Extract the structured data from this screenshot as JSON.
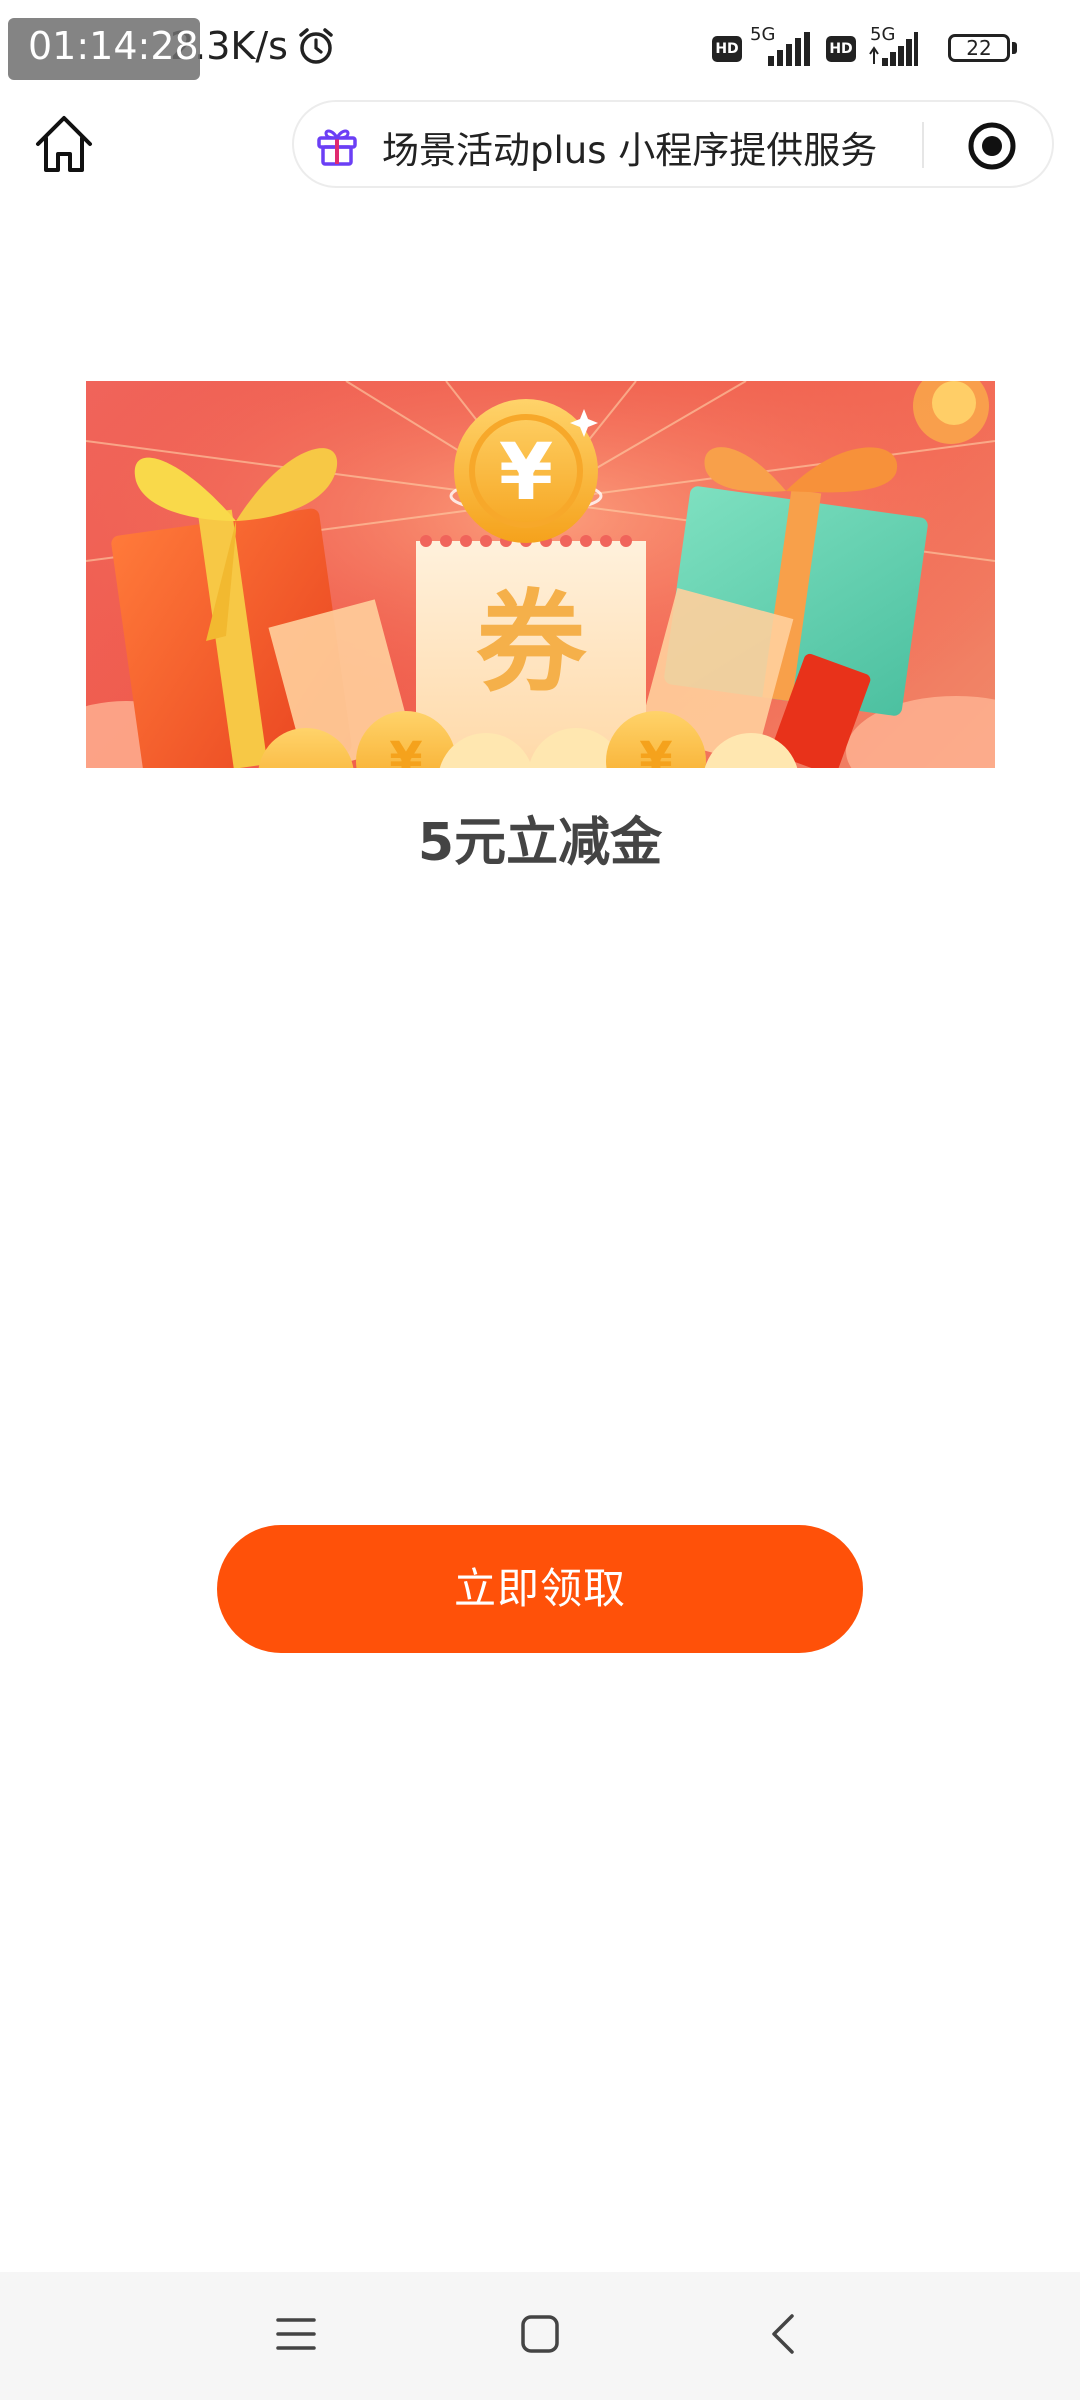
{
  "status_bar": {
    "time": "01:14:28",
    "net_speed": "2.3K/s",
    "hd_label": "HD",
    "network_label": "5G",
    "battery": "22",
    "icons": [
      "alarm-icon",
      "hd-icon",
      "signal-icon",
      "battery-icon"
    ]
  },
  "header": {
    "home_icon": "home-icon",
    "capsule": {
      "icon": "gift-icon",
      "text": "场景活动plus 小程序提供服务",
      "right_icon": "record-icon"
    }
  },
  "banner": {
    "coupon_char": "券",
    "currency_symbol": "¥"
  },
  "main": {
    "title": "5元立减金",
    "claim_button": "立即领取"
  },
  "nav_bar": {
    "icons": [
      "menu-icon",
      "home-square-icon",
      "back-icon"
    ]
  },
  "colors": {
    "accent": "#ff5109",
    "banner_red": "#ef5a4a",
    "title_gray": "#444444"
  }
}
